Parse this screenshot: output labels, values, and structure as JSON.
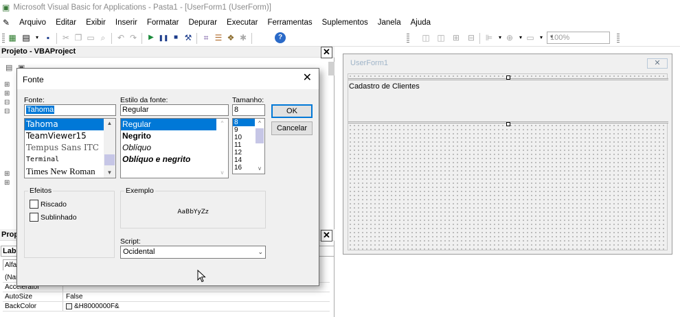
{
  "window": {
    "title": "Microsoft Visual Basic for Applications - Pasta1 - [UserForm1 (UserForm)]"
  },
  "menu": [
    "Arquivo",
    "Editar",
    "Exibir",
    "Inserir",
    "Formatar",
    "Depurar",
    "Executar",
    "Ferramentas",
    "Suplementos",
    "Janela",
    "Ajuda"
  ],
  "toolbar": {
    "zoom": "100%"
  },
  "project_panel": {
    "title": "Projeto - VBAProject",
    "close": "✕"
  },
  "properties_panel": {
    "title": "Propr",
    "object_combo": "Labe",
    "tab": "Alfa",
    "rows": [
      {
        "name": "(Nam",
        "value": ""
      },
      {
        "name": "Accelerator",
        "value": ""
      },
      {
        "name": "AutoSize",
        "value": "False"
      },
      {
        "name": "BackColor",
        "value": "&H8000000F&"
      }
    ]
  },
  "userform": {
    "title": "UserForm1",
    "close_label": "✕",
    "label_caption": "Cadastro de Clientes"
  },
  "font_dialog": {
    "title": "Fonte",
    "close": "✕",
    "font": {
      "label": "Fonte:",
      "value": "Tahoma",
      "items": [
        "Tahoma",
        "TeamViewer15",
        "Tempus Sans ITC",
        "Terminal",
        "Times New Roman"
      ]
    },
    "style": {
      "label": "Estilo da fonte:",
      "value": "Regular",
      "items": [
        "Regular",
        "Negrito",
        "Oblíquo",
        "Oblíquo e negrito"
      ]
    },
    "size": {
      "label": "Tamanho:",
      "value": "8",
      "items": [
        "8",
        "9",
        "10",
        "11",
        "12",
        "14",
        "16"
      ]
    },
    "ok": "OK",
    "cancel": "Cancelar",
    "effects": {
      "label": "Efeitos",
      "strike": "Riscado",
      "underline": "Sublinhado"
    },
    "sample": {
      "label": "Exemplo",
      "text": "AaBbYyZz"
    },
    "script": {
      "label": "Script:",
      "value": "Ocidental"
    }
  }
}
